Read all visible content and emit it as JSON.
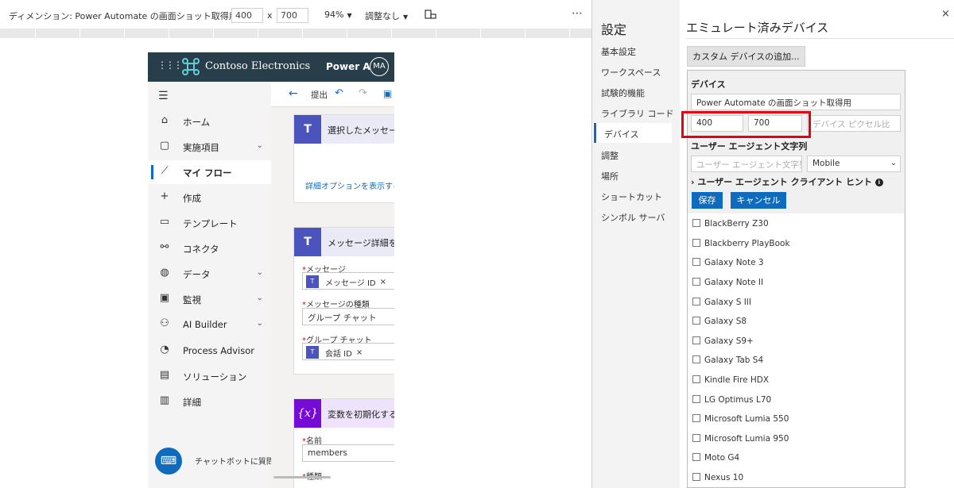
{
  "toolbar": {
    "dimension_label": "ディメンション: Power Automate の画面ショット取得用",
    "width": "400",
    "times": "x",
    "height": "700",
    "zoom": "94%",
    "throttle": "調整なし",
    "more": "⋯"
  },
  "app": {
    "waffle": "⋮⋮⋮",
    "brand": "Contoso Electronics",
    "product": "Power Au",
    "avatar": "MA"
  },
  "nav": {
    "items": [
      {
        "label": "ホーム",
        "icon": "⌂"
      },
      {
        "label": "実施項目",
        "icon": "▢",
        "chevron": "⌄"
      },
      {
        "label": "マイ フロー",
        "icon": "⟋"
      },
      {
        "label": "作成",
        "icon": "+"
      },
      {
        "label": "テンプレート",
        "icon": "▭"
      },
      {
        "label": "コネクタ",
        "icon": "⚯"
      },
      {
        "label": "データ",
        "icon": "◍",
        "chevron": "⌄"
      },
      {
        "label": "監視",
        "icon": "▣",
        "chevron": "⌄"
      },
      {
        "label": "AI Builder",
        "icon": "⚇",
        "chevron": "⌄"
      },
      {
        "label": "Process Advisor",
        "icon": "◔"
      },
      {
        "label": "ソリューション",
        "icon": "▤"
      },
      {
        "label": "詳細",
        "icon": "▥"
      }
    ],
    "chatbot": "チャットボットに質問"
  },
  "flow": {
    "back": "←",
    "submit": "提出",
    "card1_title": "選択したメッセー",
    "card1_link": "詳細オプションを表示する",
    "card2_title": "メッセージ詳細を",
    "card2_field1_label": "メッセージ",
    "card2_field1_token": "メッセージ ID",
    "card2_field2_label": "メッセージの種類",
    "card2_field2_value": "グループ チャット",
    "card2_field3_label": "グループ チャット",
    "card2_field3_token": "会話 ID",
    "card3_title": "変数を初期化する",
    "card3_field1_label": "名前",
    "card3_field1_value": "members",
    "card3_field2_label": "種類",
    "token_x": "×",
    "req": "*"
  },
  "settings": {
    "title": "設定",
    "nav": [
      "基本設定",
      "ワークスペース",
      "試験的機能",
      "ライブラリ コード",
      "デバイス",
      "調整",
      "場所",
      "ショートカット",
      "シンボル サーバ"
    ]
  },
  "devices": {
    "title": "エミュレート済みデバイス",
    "add_button": "カスタム デバイスの追加...",
    "section_label": "デバイス",
    "name_value": "Power Automate の画面ショット取得用",
    "width_value": "400",
    "height_value": "700",
    "dpr_placeholder": "デバイス ピクセル比",
    "ua_label": "ユーザー エージェント文字列",
    "ua_placeholder": "ユーザー エージェント文字列",
    "ua_type": "Mobile",
    "client_hints": "ユーザー エージェント クライアント ヒント",
    "info_icon": "i",
    "save": "保存",
    "cancel": "キャンセル",
    "list": [
      "BlackBerry Z30",
      "Blackberry PlayBook",
      "Galaxy Note 3",
      "Galaxy Note II",
      "Galaxy S III",
      "Galaxy S8",
      "Galaxy S9+",
      "Galaxy Tab S4",
      "Kindle Fire HDX",
      "LG Optimus L70",
      "Microsoft Lumia 550",
      "Microsoft Lumia 950",
      "Moto G4",
      "Nexus 10"
    ]
  },
  "close": "×"
}
